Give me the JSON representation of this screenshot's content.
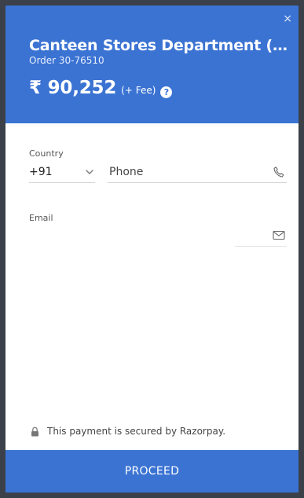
{
  "header": {
    "merchant_name": "Canteen Stores Department (D…",
    "order_id": "Order 30-76510",
    "amount": "₹ 90,252",
    "fee_note": "(+ Fee)",
    "help_symbol": "?"
  },
  "close_symbol": "×",
  "form": {
    "country_label": "Country",
    "country_value": "+91",
    "phone_placeholder": "Phone",
    "email_label": "Email"
  },
  "footer": {
    "secured_text": "This payment is secured by Razorpay.",
    "proceed_label": "PROCEED"
  },
  "icons": {
    "close": "close-icon",
    "help": "help-icon",
    "chevron": "chevron-down-icon",
    "phone": "phone-icon",
    "mail": "mail-icon",
    "lock": "lock-icon"
  },
  "colors": {
    "brand_blue": "#3b73d3",
    "backdrop": "#3c4048"
  }
}
